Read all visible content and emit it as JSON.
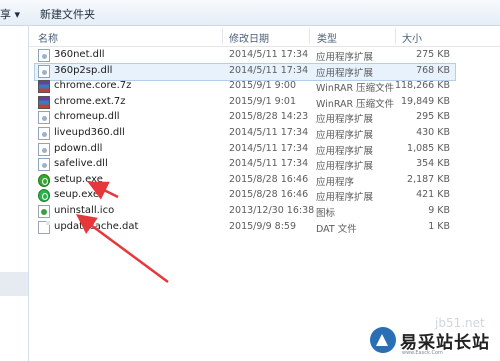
{
  "toolbar": {
    "left_label": "享 ▾",
    "new_folder": "新建文件夹"
  },
  "columns": {
    "name": "名称",
    "date": "修改日期",
    "type": "类型",
    "size": "大小"
  },
  "files": [
    {
      "name": "360net.dll",
      "date": "2014/5/11 17:34",
      "type": "应用程序扩展",
      "size": "275 KB",
      "icon": "dll-icon"
    },
    {
      "name": "360p2sp.dll",
      "date": "2014/5/11 17:34",
      "type": "应用程序扩展",
      "size": "768 KB",
      "icon": "dll-icon",
      "selected": true
    },
    {
      "name": "chrome.core.7z",
      "date": "2015/9/1 9:00",
      "type": "WinRAR 压缩文件",
      "size": "118,266 KB",
      "icon": "winrar-icon"
    },
    {
      "name": "chrome.ext.7z",
      "date": "2015/9/1 9:01",
      "type": "WinRAR 压缩文件",
      "size": "19,849 KB",
      "icon": "winrar-icon"
    },
    {
      "name": "chromeup.dll",
      "date": "2015/8/28 14:23",
      "type": "应用程序扩展",
      "size": "295 KB",
      "icon": "dll-icon"
    },
    {
      "name": "liveupd360.dll",
      "date": "2014/5/11 17:34",
      "type": "应用程序扩展",
      "size": "430 KB",
      "icon": "dll-icon"
    },
    {
      "name": "pdown.dll",
      "date": "2014/5/11 17:34",
      "type": "应用程序扩展",
      "size": "1,085 KB",
      "icon": "dll-icon"
    },
    {
      "name": "safelive.dll",
      "date": "2014/5/11 17:34",
      "type": "应用程序扩展",
      "size": "354 KB",
      "icon": "dll-icon"
    },
    {
      "name": "setup.exe",
      "date": "2015/8/28 16:46",
      "type": "应用程序",
      "size": "2,187 KB",
      "icon": "exe-icon"
    },
    {
      "name": "seup.exe",
      "date": "2015/8/28 16:46",
      "type": "应用程序扩展",
      "size": "421 KB",
      "icon": "exe-icon"
    },
    {
      "name": "uninstall.ico",
      "date": "2013/12/30 16:38",
      "type": "图标",
      "size": "9 KB",
      "icon": "ico-icon"
    },
    {
      "name": "updatecache.dat",
      "date": "2015/9/9 8:59",
      "type": "DAT 文件",
      "size": "1 KB",
      "icon": "dat-icon"
    }
  ],
  "watermark": {
    "brand": "易采站长站",
    "url": "www.Easck.Com",
    "faint": "jb51.net"
  },
  "colors": {
    "arrow": "#e5383b",
    "selection": "#e8f2fc"
  }
}
